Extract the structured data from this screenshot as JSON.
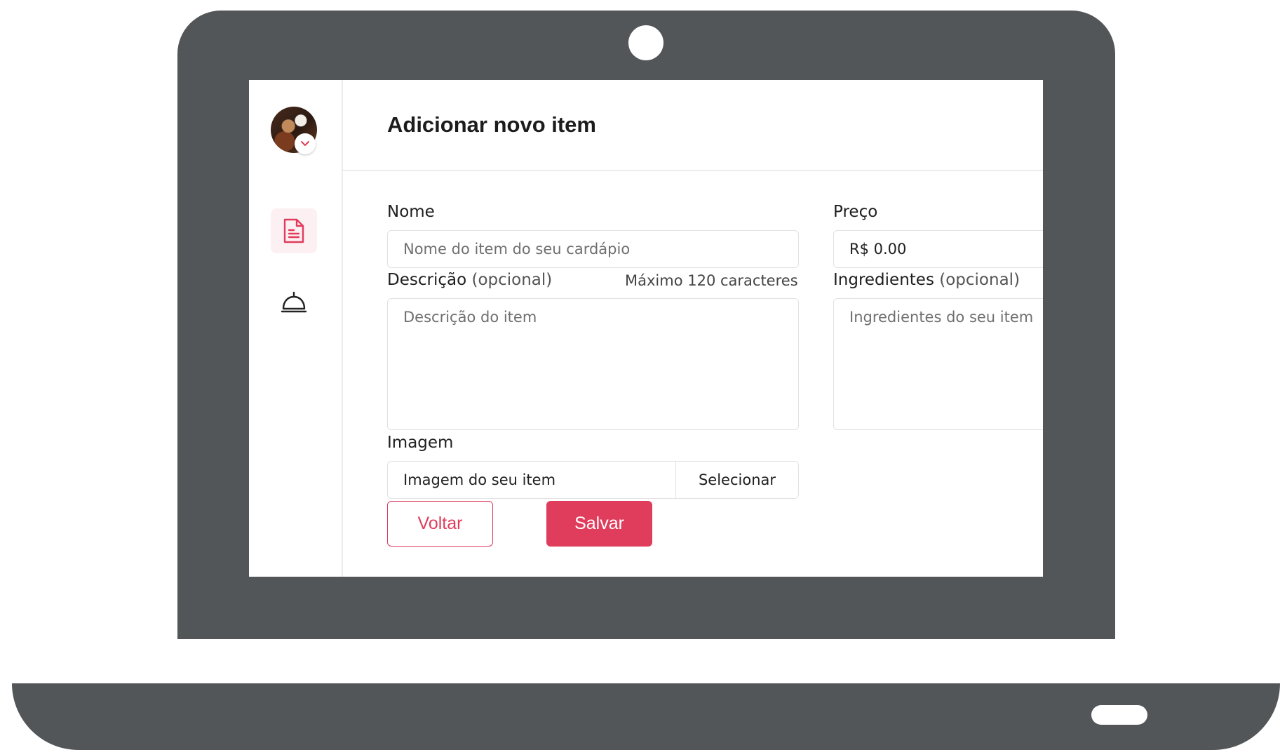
{
  "page": {
    "title": "Adicionar novo item"
  },
  "sidebar": {
    "items": [
      {
        "name": "menu",
        "icon": "document-icon",
        "active": true
      },
      {
        "name": "orders",
        "icon": "cloche-icon",
        "active": false
      }
    ]
  },
  "form": {
    "name": {
      "label": "Nome",
      "placeholder": "Nome do item do seu cardápio"
    },
    "price": {
      "label": "Preço",
      "value": "R$ 0.00"
    },
    "description": {
      "label": "Descrição",
      "optional": "(opcional)",
      "hint": "Máximo 120 caracteres",
      "placeholder": "Descrição do item"
    },
    "ingredients": {
      "label": "Ingredientes",
      "optional": "(opcional)",
      "placeholder": "Ingredientes do seu item"
    },
    "image": {
      "label": "Imagem",
      "placeholder": "Imagem do seu item",
      "button": "Selecionar"
    }
  },
  "actions": {
    "back": "Voltar",
    "save": "Salvar"
  },
  "colors": {
    "accent": "#e03d5c",
    "frame": "#525659"
  }
}
